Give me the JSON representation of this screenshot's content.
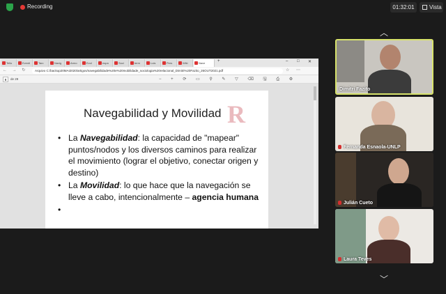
{
  "topbar": {
    "recording_label": "Recording",
    "clock": "01:32:01",
    "view_label": "Vista"
  },
  "browser": {
    "tabs": [
      "Tello",
      "Eventi",
      "Tarc",
      "Navig",
      "Armo",
      "Evol",
      "espa",
      "Soci",
      "term",
      "Luis",
      "Pers",
      "Wiki",
      "Nave"
    ],
    "address": "Arquivo   C:/backup20MAI2020/artigos/navegabilidade%20e%20mobilidade_sociologia%20relacional_Dimitri%20Fazito_26OUT2021.pdf",
    "page_number": "8",
    "page_total": "de 29"
  },
  "slide": {
    "title": "Navegabilidad y Movilidad",
    "logo": "R",
    "bullet1_pre": "La ",
    "bullet1_term": "Navegabilidad",
    "bullet1_text": ": la capacidad de \"mapear\" puntos/nodos y los diversos caminos para realizar el movimiento (lograr el objetivo, conectar origen y destino)",
    "bullet2_pre": "La ",
    "bullet2_term": "Movilidad",
    "bullet2_text": ": lo que hace que la navegación se lleve a cabo, intencionalmente – ",
    "bullet2_bold": "agencia humana"
  },
  "participants": [
    {
      "name": "Dimitri Fazito"
    },
    {
      "name": "Fernanda Esnaola-UNLP"
    },
    {
      "name": "Julián Cueto"
    },
    {
      "name": "Laura Teves"
    }
  ],
  "colors": {
    "recording": "#e53935",
    "active_speaker_border": "#d8e36b",
    "logo": "#e6a9ae"
  }
}
